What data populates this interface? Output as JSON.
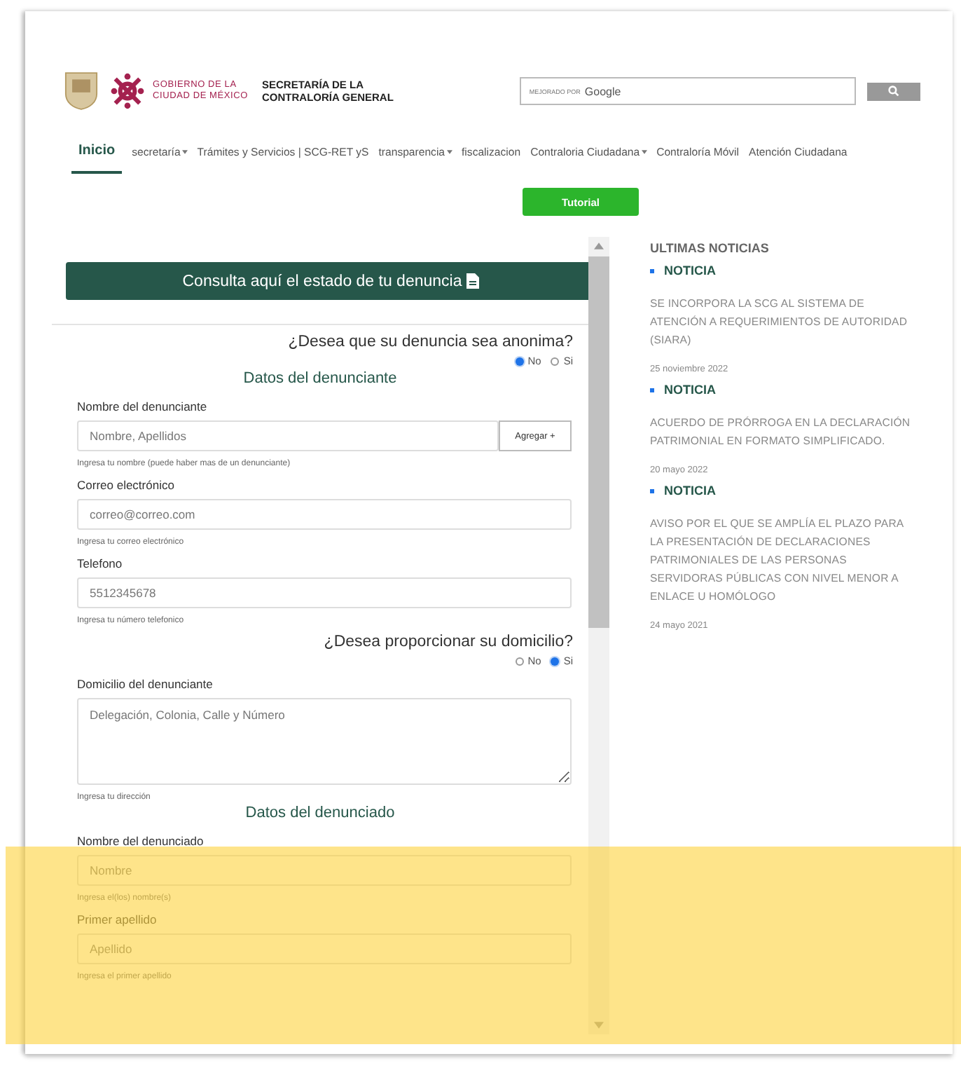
{
  "header": {
    "gov_lines": [
      "GOBIERNO DE LA",
      "CIUDAD DE MÉXICO"
    ],
    "agency_lines": [
      "SECRETARÍA DE LA",
      "CONTRALORÍA GENERAL"
    ],
    "search": {
      "powered_by": "MEJORADO POR",
      "brand": "Google"
    }
  },
  "nav": [
    {
      "label": "Inicio",
      "selected": true,
      "dropdown": false
    },
    {
      "label": "secretaría",
      "selected": false,
      "dropdown": true
    },
    {
      "label": "Trámites y Servicios | SCG-RET yS",
      "selected": false,
      "dropdown": false
    },
    {
      "label": "transparencia",
      "selected": false,
      "dropdown": true
    },
    {
      "label": "fiscalizacion",
      "selected": false,
      "dropdown": false
    },
    {
      "label": "Contraloria Ciudadana",
      "selected": false,
      "dropdown": true
    },
    {
      "label": "Contraloría Móvil",
      "selected": false,
      "dropdown": false
    },
    {
      "label": "Atención Ciudadana",
      "selected": false,
      "dropdown": false
    }
  ],
  "tutorial_button": "Tutorial",
  "status_button": "Consulta aquí el estado de tu denuncia",
  "form": [
    {
      "kind": "question",
      "text": "¿Desea que su denuncia sea anonima?",
      "options": [
        {
          "label": "No",
          "selected": true
        },
        {
          "label": "Si",
          "selected": false
        }
      ]
    },
    {
      "kind": "heading",
      "text": "Datos del denunciante"
    },
    {
      "kind": "field",
      "label": "Nombre del denunciante",
      "placeholder": "Nombre, Apellidos",
      "button": "Agregar +",
      "hint": "Ingresa tu nombre (puede haber mas de un denunciante)"
    },
    {
      "kind": "field",
      "label": "Correo electrónico",
      "placeholder": "correo@correo.com",
      "hint": "Ingresa tu correo electrónico"
    },
    {
      "kind": "field",
      "label": "Telefono",
      "placeholder": "5512345678",
      "hint": "Ingresa tu número telefonico"
    },
    {
      "kind": "question",
      "text": "¿Desea proporcionar su domicilio?",
      "options": [
        {
          "label": "No",
          "selected": false
        },
        {
          "label": "Si",
          "selected": true
        }
      ]
    },
    {
      "kind": "textarea",
      "label": "Domicilio del denunciante",
      "placeholder": "Delegación, Colonia, Calle y Número",
      "hint": "Ingresa tu dirección"
    },
    {
      "kind": "heading",
      "text": "Datos del denunciado"
    },
    {
      "kind": "field",
      "label": "Nombre del denunciado",
      "placeholder": "Nombre",
      "hint": "Ingresa el(los) nombre(s)"
    },
    {
      "kind": "field",
      "label": "Primer apellido",
      "placeholder": "Apellido",
      "hint": "Ingresa el primer apellido"
    }
  ],
  "news": {
    "title": "ULTIMAS NOTICIAS",
    "items": [
      {
        "tag": "NOTICIA",
        "headline": "SE INCORPORA LA SCG AL SISTEMA DE ATENCIÓN A REQUERIMIENTOS DE AUTORIDAD (SIARA)",
        "date": "25 noviembre 2022"
      },
      {
        "tag": "NOTICIA",
        "headline": "ACUERDO DE PRÓRROGA EN LA DECLARACIÓN PATRIMONIAL EN FORMATO SIMPLIFICADO.",
        "date": "20 mayo 2022"
      },
      {
        "tag": "NOTICIA",
        "headline": "AVISO POR EL QUE SE AMPLÍA EL PLAZO PARA LA PRESENTACIÓN DE DECLARACIONES PATRIMONIALES DE LAS PERSONAS SERVIDORAS PÚBLICAS CON NIVEL MENOR A ENLACE U HOMÓLOGO",
        "date": "24 mayo 2021"
      }
    ]
  }
}
